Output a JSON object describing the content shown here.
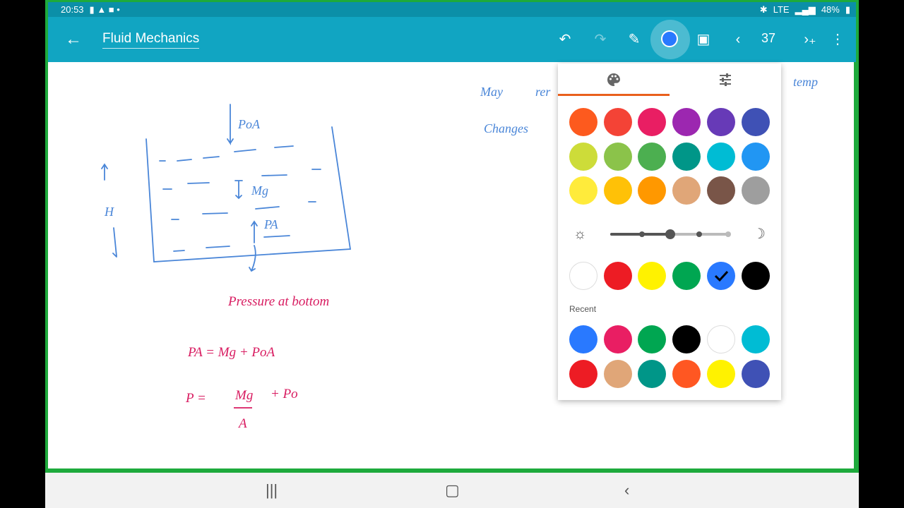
{
  "status": {
    "time": "20:53",
    "battery": "48%",
    "signal": "LTE"
  },
  "appbar": {
    "title": "Fluid Mechanics",
    "page": "37"
  },
  "colors": {
    "bright": [
      "#fd5a1e",
      "#f44336",
      "#e91e63",
      "#9c27b0",
      "#673ab7",
      "#3f51b5",
      "#cddc39",
      "#8bc34a",
      "#4caf50",
      "#009688",
      "#00bcd4",
      "#2196f3",
      "#ffeb3b",
      "#ffc107",
      "#ff9800",
      "#e0a678",
      "#795548",
      "#9e9e9e"
    ],
    "basic": [
      "#ffffff",
      "#ed1c24",
      "#fff200",
      "#00a651",
      "#2979ff",
      "#000000"
    ],
    "basic_selected": 4,
    "recent_label": "Recent",
    "recent": [
      "#2979ff",
      "#e91e63",
      "#00a651",
      "#000000",
      "#ffffff",
      "#00bcd4",
      "#ed1c24",
      "#e0a678",
      "#009688",
      "#ff5722",
      "#fff200",
      "#3f51b5"
    ]
  },
  "brightness": 0.5,
  "notes": {
    "p0a": "PoA",
    "h": "H",
    "mg": "Mg",
    "pa": "PA",
    "pressure": "Pressure at bottom",
    "eq1": "PA = Mg + PoA",
    "eq2_left": "P =",
    "eq2_num": "Mg",
    "eq2_den": "A",
    "eq2_right": "+ Po",
    "right1a": "May",
    "right1b": "rer",
    "right1c": "temp",
    "right2": "Changes"
  }
}
